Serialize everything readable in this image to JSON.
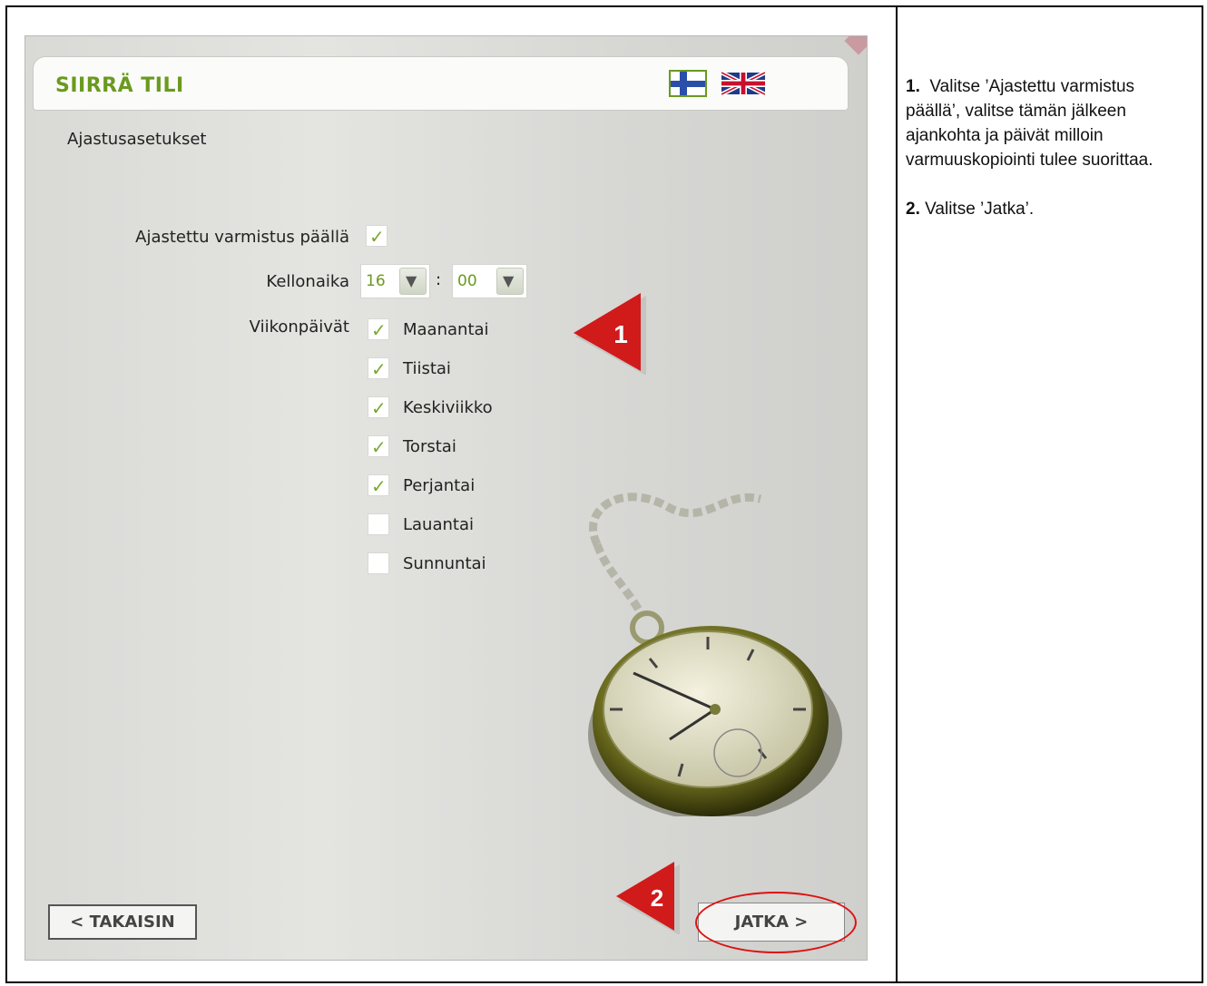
{
  "app": {
    "title": "SIIRRÄ TILI",
    "section_title": "Ajastusasetukset",
    "accent_color": "#6a9a1e",
    "languages": [
      {
        "icon": "finnish-flag-icon"
      },
      {
        "icon": "uk-flag-icon"
      }
    ]
  },
  "form": {
    "scheduled_label": "Ajastettu varmistus päällä",
    "scheduled_checked": true,
    "time_label": "Kellonaika",
    "hour_value": "16",
    "minute_value": "00",
    "time_separator": ":",
    "weekdays_label": "Viikonpäivät",
    "days": [
      {
        "label": "Maanantai",
        "checked": true
      },
      {
        "label": "Tiistai",
        "checked": true
      },
      {
        "label": "Keskiviikko",
        "checked": true
      },
      {
        "label": "Torstai",
        "checked": true
      },
      {
        "label": "Perjantai",
        "checked": true
      },
      {
        "label": "Lauantai",
        "checked": false
      },
      {
        "label": "Sunnuntai",
        "checked": false
      }
    ]
  },
  "buttons": {
    "back_label": "< TAKAISIN",
    "next_label": "JATKA >"
  },
  "markers": {
    "step1": "1",
    "step2": "2",
    "color": "#d11a1a"
  },
  "instructions": {
    "step1_num": "1.",
    "step1_text": "Valitse ’Ajastettu varmistus päällä’, valitse tämän jälkeen ajankohta ja päivät milloin varmuuskopiointi tulee suorittaa.",
    "step2_num": "2.",
    "step2_text": "Valitse ’Jatka’."
  }
}
